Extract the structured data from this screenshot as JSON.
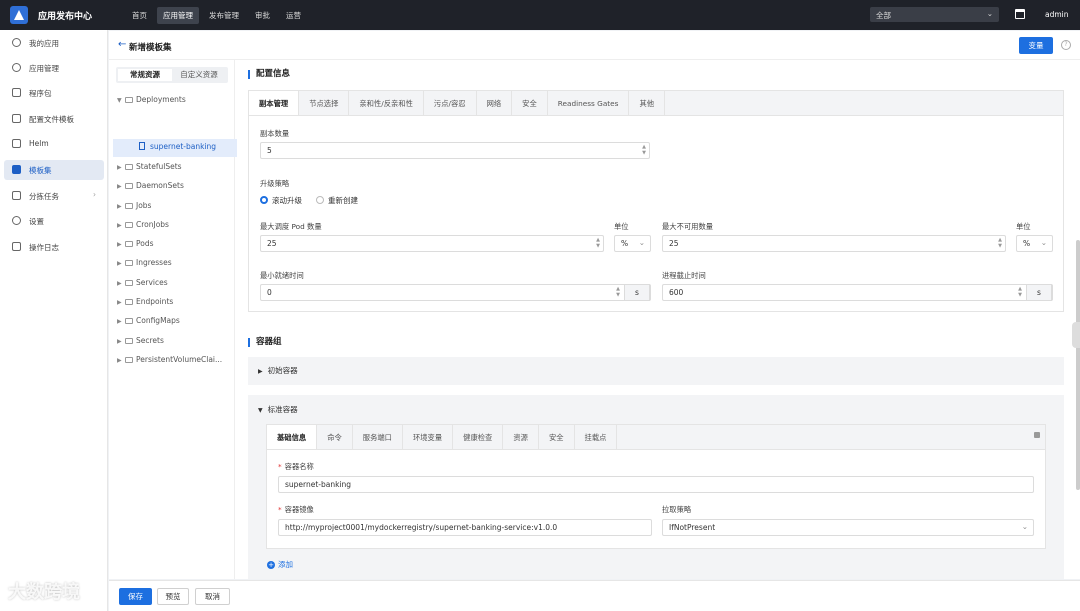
{
  "app": {
    "title": "应用发布中心",
    "user": "admin"
  },
  "topnav": [
    "首页",
    "应用管理",
    "发布管理",
    "审批",
    "运营"
  ],
  "scope": {
    "value": "全部"
  },
  "sidebar": [
    {
      "label": "我的应用"
    },
    {
      "label": "应用管理"
    },
    {
      "label": "程序包"
    },
    {
      "label": "配置文件模板"
    },
    {
      "label": "Helm"
    },
    {
      "label": "模板集"
    },
    {
      "label": "分拣任务"
    },
    {
      "label": "设置"
    },
    {
      "label": "操作日志"
    }
  ],
  "page": {
    "title": "新增模板集",
    "variables_button": "变量",
    "help": "?"
  },
  "tree": {
    "segments": [
      "常规资源",
      "自定义资源"
    ],
    "nodes": [
      "Deployments",
      "StatefulSets",
      "DaemonSets",
      "Jobs",
      "CronJobs",
      "Pods",
      "Ingresses",
      "Services",
      "Endpoints",
      "ConfigMaps",
      "Secrets",
      "PersistentVolumeClai..."
    ],
    "selected_child": "supernet-banking"
  },
  "config": {
    "title": "配置信息",
    "tabs": [
      "副本管理",
      "节点选择",
      "亲和性/反亲和性",
      "污点/容忍",
      "网络",
      "安全",
      "Readiness Gates",
      "其他"
    ],
    "replicas": {
      "label": "副本数量",
      "value": "5"
    },
    "strategy": {
      "label": "升级策略",
      "options": [
        "滚动升级",
        "重新创建"
      ],
      "selected": "滚动升级"
    },
    "max_surge": {
      "label": "最大调度 Pod 数量",
      "value": "25",
      "unit_label": "单位",
      "unit": "%"
    },
    "max_unavailable": {
      "label": "最大不可用数量",
      "value": "25",
      "unit_label": "单位",
      "unit": "%"
    },
    "min_ready": {
      "label": "最小就绪时间",
      "value": "0",
      "suffix": "s"
    },
    "progress_deadline": {
      "label": "进程截止时间",
      "value": "600",
      "suffix": "s"
    }
  },
  "containers": {
    "title": "容器组",
    "init_label": "初始容器",
    "standard_label": "标准容器",
    "tabs": [
      "基础信息",
      "命令",
      "服务端口",
      "环境变量",
      "健康检查",
      "资源",
      "安全",
      "挂载点"
    ],
    "name": {
      "label": "容器名称",
      "value": "supernet-banking"
    },
    "image": {
      "label": "容器镜像",
      "value": "http://myproject0001/mydockerregistry/supernet-banking-service:v1.0.0"
    },
    "pull_policy": {
      "label": "拉取策略",
      "value": "IfNotPresent"
    },
    "add": "添加"
  },
  "footer": {
    "buttons": [
      "保存",
      "预览",
      "取消"
    ]
  },
  "watermark": "大数跨境"
}
